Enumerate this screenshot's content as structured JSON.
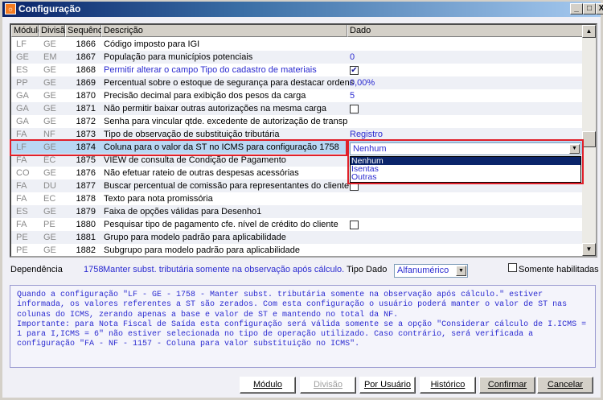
{
  "window": {
    "title": "Configuração",
    "controls": [
      "_",
      "□",
      "X"
    ]
  },
  "table": {
    "headers": [
      "Módulo",
      "Divisão",
      "Sequência",
      "Descrição",
      "Dado"
    ],
    "rows": [
      {
        "mod": "LF",
        "div": "GE",
        "seq": "1866",
        "desc": "Código imposto para IGI",
        "dado": "",
        "type": "text"
      },
      {
        "mod": "GE",
        "div": "EM",
        "seq": "1867",
        "desc": "População para municípios potenciais",
        "dado": "0",
        "type": "text"
      },
      {
        "mod": "ES",
        "div": "GE",
        "seq": "1868",
        "desc": "Permitir alterar o campo Tipo do cadastro de materiais",
        "dado": "",
        "type": "checked"
      },
      {
        "mod": "PP",
        "div": "GE",
        "seq": "1869",
        "desc": "Percentual sobre o estoque de segurança para destacar ordens",
        "dado": "0,00%",
        "type": "text"
      },
      {
        "mod": "GA",
        "div": "GE",
        "seq": "1870",
        "desc": "Precisão decimal para exibição dos pesos da carga",
        "dado": "5",
        "type": "text"
      },
      {
        "mod": "GA",
        "div": "GE",
        "seq": "1871",
        "desc": "Não permitir baixar outras autorizações na mesma carga",
        "dado": "",
        "type": "unchecked"
      },
      {
        "mod": "GA",
        "div": "GE",
        "seq": "1872",
        "desc": "Senha para vincular qtde. excedente de autorização de transp",
        "dado": "",
        "type": "text"
      },
      {
        "mod": "FA",
        "div": "NF",
        "seq": "1873",
        "desc": "Tipo de observação de substituição tributária",
        "dado": "Registro",
        "type": "text"
      },
      {
        "mod": "LF",
        "div": "GE",
        "seq": "1874",
        "desc": "Coluna para o valor da ST no ICMS para configuração 1758",
        "dado": "",
        "type": "combo"
      },
      {
        "mod": "FA",
        "div": "EC",
        "seq": "1875",
        "desc": "VIEW de consulta de Condição de Pagamento",
        "dado": "",
        "type": "text"
      },
      {
        "mod": "CO",
        "div": "GE",
        "seq": "1876",
        "desc": "Não efetuar rateio de outras despesas acessórias",
        "dado": "",
        "type": "text"
      },
      {
        "mod": "FA",
        "div": "DU",
        "seq": "1877",
        "desc": "Buscar percentual de comissão para representantes do cliente",
        "dado": "",
        "type": "unchecked"
      },
      {
        "mod": "FA",
        "div": "EC",
        "seq": "1878",
        "desc": "Texto para nota promissória",
        "dado": "",
        "type": "text"
      },
      {
        "mod": "ES",
        "div": "GE",
        "seq": "1879",
        "desc": "Faixa de opções válidas para Desenho1",
        "dado": "",
        "type": "text"
      },
      {
        "mod": "FA",
        "div": "PE",
        "seq": "1880",
        "desc": "Pesquisar tipo de pagamento cfe. nível de crédito do cliente",
        "dado": "",
        "type": "unchecked"
      },
      {
        "mod": "PE",
        "div": "GE",
        "seq": "1881",
        "desc": "Grupo para modelo padrão para aplicabilidade",
        "dado": "",
        "type": "text"
      },
      {
        "mod": "PE",
        "div": "GE",
        "seq": "1882",
        "desc": "Subgrupo para modelo padrão para aplicabilidade",
        "dado": "",
        "type": "text"
      }
    ],
    "selected_seq": "1874"
  },
  "combo": {
    "value": "Nenhum",
    "options": [
      "Nenhum",
      "Isentas",
      "Outras"
    ]
  },
  "footer": {
    "dependencia_label": "Dependência",
    "dependencia_seq": "1758",
    "dependencia_text": "Manter subst. tributária somente na observação após cálculo.",
    "tipo_dado_label": "Tipo Dado",
    "tipo_dado_value": "Alfanumérico",
    "somente_label": "Somente habilitadas"
  },
  "help_text": "Quando a configuração \"LF - GE - 1758 - Manter subst. tributária somente na observação após cálculo.\" estiver informada, os valores referentes a ST são zerados. Com esta configuração o usuário poderá manter o valor de ST nas colunas do ICMS, zerando apenas a base e valor de ST e mantendo no total da NF.\nImportante: para Nota Fiscal de Saída esta configuração será válida somente se a opção \"Considerar cálculo de I.ICMS = 1 para I,ICMS = 6\" não estiver selecionada no tipo de operação utilizado. Caso contrário, será verificada a configuração \"FA - NF - 1157 - Coluna para valor substituição no ICMS\".",
  "buttons": {
    "modulo": "Módulo",
    "divisao": "Divisão",
    "por_usuario": "Por Usuário",
    "historico": "Histórico",
    "confirmar": "Confirmar",
    "cancelar": "Cancelar"
  }
}
